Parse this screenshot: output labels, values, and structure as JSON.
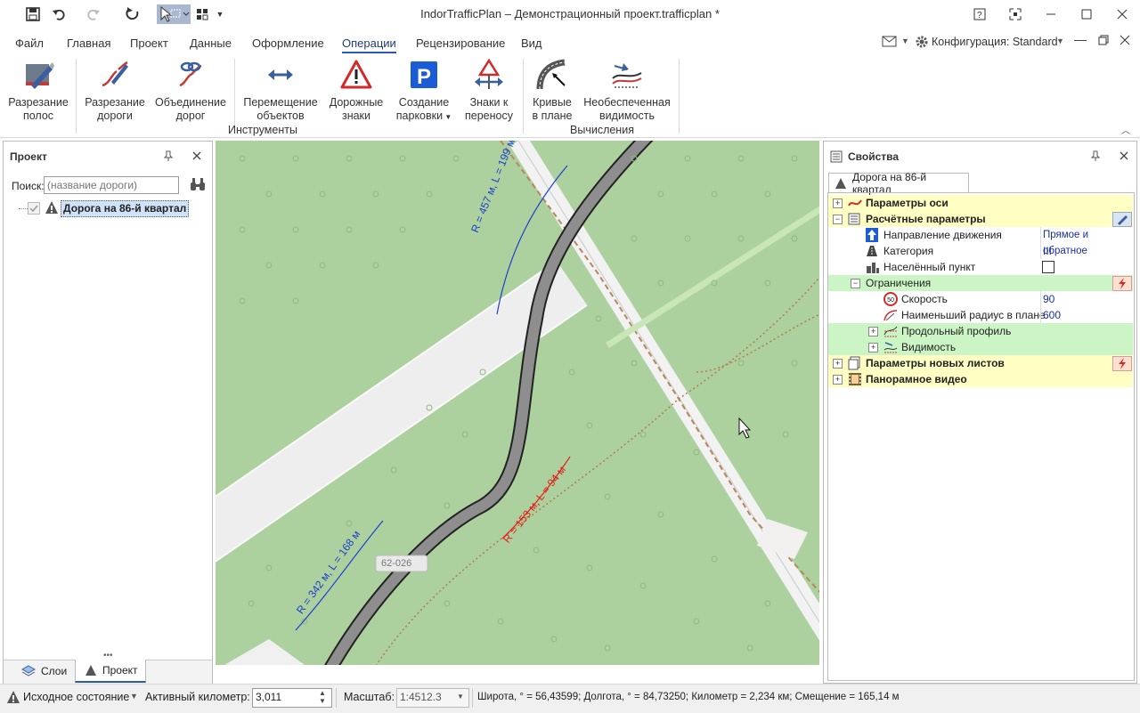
{
  "window": {
    "title": "IndorTrafficPlan – Демонстрационный проект.trafficplan *"
  },
  "menu": {
    "tabs": [
      "Файл",
      "Главная",
      "Проект",
      "Данные",
      "Оформление",
      "Операции",
      "Рецензирование",
      "Вид"
    ],
    "active": "Операции"
  },
  "config": {
    "label": "Конфигурация: Standard"
  },
  "ribbon": {
    "buttons": [
      {
        "line1": "Разрезание",
        "line2": "полос"
      },
      {
        "line1": "Разрезание",
        "line2": "дороги"
      },
      {
        "line1": "Объединение",
        "line2": "дорог"
      },
      {
        "line1": "Перемещение",
        "line2": "объектов"
      },
      {
        "line1": "Дорожные",
        "line2": "знаки"
      },
      {
        "line1": "Создание",
        "line2": "парковки"
      },
      {
        "line1": "Знаки к",
        "line2": "переносу"
      },
      {
        "line1": "Кривые",
        "line2": "в плане"
      },
      {
        "line1": "Необеспеченная",
        "line2": "видимость"
      }
    ],
    "groups": {
      "tools": "Инструменты",
      "calc": "Вычисления"
    }
  },
  "project_panel": {
    "title": "Проект",
    "search_label": "Поиск:",
    "search_placeholder": "(название дороги)",
    "road_item": "Дорога на 86-й квартал",
    "tabs": [
      "Слои",
      "Проект"
    ]
  },
  "map": {
    "curve_labels": [
      "R = 457 м, L = 199 м",
      "R = 342 м, L = 168 м",
      "R = 153 м, L = 94 м"
    ],
    "road_ref": "62-026"
  },
  "props_panel": {
    "title": "Свойства",
    "tab": "Дорога на 86-й квартал",
    "rows": {
      "axis": "Параметры оси",
      "calc": "Расчётные параметры",
      "direction": "Направление движения",
      "direction_val": "Прямое и обратное",
      "category": "Категория",
      "category_val": "III",
      "settlement": "Населённый пункт",
      "limits": "Ограничения",
      "speed": "Скорость",
      "speed_icon": "50",
      "speed_val": "90",
      "radius": "Наименьший радиус в плане",
      "radius_val": "600",
      "profile": "Продольный профиль",
      "visibility": "Видимость",
      "sheets": "Параметры новых листов",
      "video": "Панорамное видео"
    }
  },
  "status": {
    "state": "Исходное состояние",
    "km_label": "Активный километр:",
    "km_value": "3,011",
    "scale_label": "Масштаб:",
    "scale_value": "1:4512.3",
    "coords": "Широта, ° = 56,43599; Долгота, ° = 84,73250; Километр = 2,234 км; Смещение = 165,14 м"
  },
  "colors": {
    "accent": "#2b59b8",
    "map_bg": "#add19e",
    "limits_bg": "#ccf5c5",
    "section_bg": "#ffffc4"
  }
}
